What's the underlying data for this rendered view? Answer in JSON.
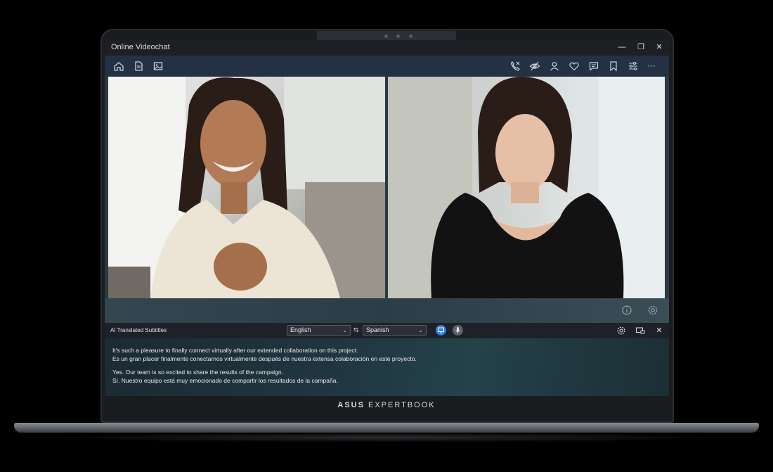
{
  "window": {
    "title": "Online Videochat",
    "controls": {
      "minimize": "—",
      "restore": "❐",
      "close": "✕"
    }
  },
  "toolbar": {
    "left_icons": [
      "home-icon",
      "document-icon",
      "image-icon"
    ],
    "right_icons": [
      "call-icon",
      "hide-icon",
      "person-icon",
      "heart-icon",
      "chat-icon",
      "bookmark-icon",
      "sliders-icon",
      "more-icon"
    ],
    "more": "···"
  },
  "video": {
    "participants": [
      "participant-left",
      "participant-right"
    ]
  },
  "subtitles": {
    "label": "AI Translated Subtitles",
    "source_language": "English",
    "target_language": "Spanish",
    "swap": "⇆",
    "accent": "#2f7fe0",
    "captions": [
      "It's such a pleasure to finally connect virtually after our extended collaboration on this project.",
      "Es un gran placer finalmente conectarnos virtualmente después de nuestra extensa colaboración en este proyecto.",
      "Yes. Our team is so excited to share the results of the campaign.",
      "Sí. Nuestro equipo está muy emocionado de compartir los resultados de la campaña."
    ]
  },
  "brand": {
    "part1": "ASUS",
    "part2": "EXPERTBOOK"
  }
}
